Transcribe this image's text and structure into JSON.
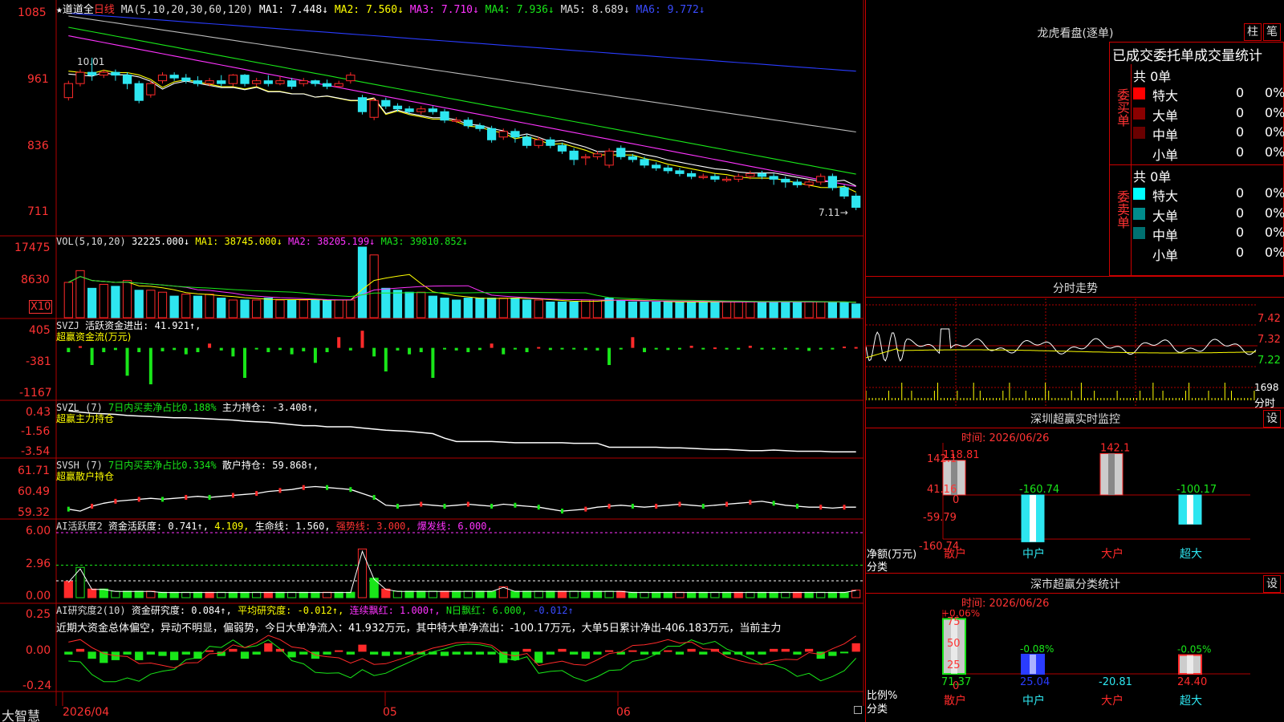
{
  "colors": {
    "up": "#ff2a2a",
    "down": "#2ee6f0",
    "green": "#19e619",
    "yellow": "#ffff00",
    "magenta": "#ff33ff",
    "grid": "#b00000",
    "white": "#ffffff",
    "blue": "#2a3cff"
  },
  "header": {
    "star": "★",
    "name": "道道全",
    "period": "日线",
    "ma_label": "MA(5,10,20,30,60,120)",
    "ma1": "MA1: 7.448↓",
    "ma2": "MA2: 7.560↓",
    "ma3": "MA3: 7.710↓",
    "ma4": "MA4: 7.936↓",
    "ma5": "MA5: 8.689↓",
    "ma6": "MA6: 9.772↓"
  },
  "main_axis": {
    "t1": "1085",
    "t2": "961",
    "t3": "836",
    "t4": "711"
  },
  "main_annot": {
    "high": "10.01",
    "low": "7.11→"
  },
  "vol": {
    "label": "VOL(5,10,20)",
    "v": "32225.000↓",
    "ma1": "MA1: 38745.000↓",
    "ma2": "MA2: 38205.199↓",
    "ma3": "MA3: 39810.852↓",
    "t1": "17475",
    "t2": "8630",
    "unit": "X10"
  },
  "svzj": {
    "label": "SVZJ",
    "val": "活跃资金进出: 41.921↑,",
    "sub": "超赢资金流(万元)",
    "t1": "405",
    "t2": "-381",
    "t3": "-1167"
  },
  "svzl": {
    "label": "SVZL (7)",
    "g": "7日内买卖净占比0.188%",
    "w": "主力持仓: -3.408↑,",
    "sub": "超赢主力持仓",
    "t1": "0.43",
    "t2": "-1.56",
    "t3": "-3.54"
  },
  "svsh": {
    "label": "SVSH (7)",
    "g": "7日内买卖净占比0.334%",
    "w": "散户持仓: 59.868↑,",
    "sub": "超赢散户持仓",
    "t1": "61.71",
    "t2": "60.49",
    "t3": "59.32"
  },
  "ai1": {
    "label": "AI活跃度2",
    "a": "资金活跃度: 0.741↑,",
    "b": "4.109,",
    "c": "生命线: 1.560,",
    "d": "强势线: 3.000,",
    "e": "爆发线: 6.000,",
    "t1": "6.00",
    "t2": "2.96",
    "t3": "0.00"
  },
  "ai2": {
    "label": "AI研究度2(10)",
    "a": "资金研究度: 0.084↑,",
    "b": "平均研究度: -0.012↑,",
    "c": "连续飘红: 1.000↑,",
    "d": "N日飘红: 6.000,",
    "e": "-0.012↑",
    "comment": "近期大资金总体偏空，异动不明显，偏弱势，今日大单净流入：41.932万元，其中特大单净流出：-100.17万元，大单5日累计净出-406.183万元，当前主力",
    "t1": "0.25",
    "t2": "0.00",
    "t3": "-0.24"
  },
  "bottom": {
    "brand": "大智慧",
    "d1": "2026/04",
    "d2": "05",
    "d3": "06"
  },
  "right": {
    "title": "龙虎看盘(逐单)",
    "btn1": "柱",
    "btn2": "笔",
    "sub_title": "已成交委托单成交量统计",
    "buy_side": "委买单",
    "sell_side": "委卖单",
    "buy_total": "共 0单",
    "sell_total": "共 0单",
    "buy_rows": [
      {
        "name": "特大",
        "n": "0",
        "p": "0%",
        "color": "#ff0000"
      },
      {
        "name": "大单",
        "n": "0",
        "p": "0%",
        "color": "#8b0000"
      },
      {
        "name": "中单",
        "n": "0",
        "p": "0%",
        "color": "#6a0000"
      },
      {
        "name": "小单",
        "n": "0",
        "p": "0%",
        "color": ""
      }
    ],
    "sell_rows": [
      {
        "name": "特大",
        "n": "0",
        "p": "0%",
        "color": "#00ffff"
      },
      {
        "name": "大单",
        "n": "0",
        "p": "0%",
        "color": "#008b8b"
      },
      {
        "name": "中单",
        "n": "0",
        "p": "0%",
        "color": "#007070"
      },
      {
        "name": "小单",
        "n": "0",
        "p": "0%",
        "color": ""
      }
    ],
    "intraday_title": "分时走势",
    "intraday_ticks": {
      "p1": "7.42",
      "p2": "7.32",
      "p3": "7.22",
      "v": "1698",
      "unit": "分时"
    },
    "monitor_title": "深圳超赢实时监控",
    "monitor_btn": "设",
    "monitor_time": "时间: 2026/06/26",
    "monitor_axis": {
      "t1": "142.1",
      "t2": "41.16",
      "t3": "0",
      "t4": "-59.79",
      "t5": "-160.74",
      "unit1": "净额(万元)",
      "unit2": "分类"
    },
    "stats_title": "深市超赢分类统计",
    "stats_btn": "设",
    "stats_time": "时间: 2026/06/26",
    "stats_axis": {
      "t1": "75",
      "t2": "50",
      "t3": "25",
      "t4": "0",
      "unit1": "比例%",
      "unit2": "分类"
    }
  },
  "chart_data": [
    {
      "type": "candlestick",
      "title": "道道全 日线",
      "ylim": [
        6.9,
        10.95
      ],
      "ohlc": [
        [
          9.3,
          9.55,
          9.25,
          9.6
        ],
        [
          9.55,
          9.75,
          9.5,
          9.8
        ],
        [
          9.75,
          9.7,
          9.6,
          10.01
        ],
        [
          9.7,
          9.75,
          9.65,
          9.8
        ],
        [
          9.75,
          9.7,
          9.6,
          9.8
        ],
        [
          9.7,
          9.55,
          9.45,
          9.75
        ],
        [
          9.55,
          9.25,
          9.2,
          9.6
        ],
        [
          9.35,
          9.55,
          9.3,
          9.6
        ],
        [
          9.6,
          9.7,
          9.55,
          9.75
        ],
        [
          9.7,
          9.65,
          9.6,
          9.75
        ],
        [
          9.65,
          9.6,
          9.55,
          9.72
        ],
        [
          9.6,
          9.55,
          9.5,
          9.68
        ],
        [
          9.55,
          9.6,
          9.5,
          9.65
        ],
        [
          9.6,
          9.55,
          9.5,
          9.7
        ],
        [
          9.55,
          9.7,
          9.5,
          9.72
        ],
        [
          9.7,
          9.55,
          9.5,
          9.72
        ],
        [
          9.55,
          9.6,
          9.5,
          9.65
        ],
        [
          9.6,
          9.55,
          9.5,
          9.7
        ],
        [
          9.55,
          9.6,
          9.52,
          9.68
        ],
        [
          9.6,
          9.5,
          9.45,
          9.65
        ],
        [
          9.55,
          9.6,
          9.5,
          9.65
        ],
        [
          9.6,
          9.55,
          9.5,
          9.62
        ],
        [
          9.55,
          9.5,
          9.45,
          9.62
        ],
        [
          9.5,
          9.55,
          9.48,
          9.6
        ],
        [
          9.6,
          9.7,
          9.55,
          9.75
        ],
        [
          9.3,
          9.05,
          9.0,
          9.35
        ],
        [
          8.95,
          9.25,
          8.9,
          9.3
        ],
        [
          9.25,
          9.15,
          9.1,
          9.3
        ],
        [
          9.15,
          9.1,
          9.05,
          9.2
        ],
        [
          9.1,
          9.05,
          9.0,
          9.15
        ],
        [
          9.05,
          9.1,
          9.0,
          9.15
        ],
        [
          9.1,
          9.05,
          9.0,
          9.15
        ],
        [
          9.05,
          8.9,
          8.85,
          9.1
        ],
        [
          8.9,
          8.9,
          8.85,
          8.95
        ],
        [
          8.9,
          8.8,
          8.75,
          8.95
        ],
        [
          8.8,
          8.75,
          8.7,
          8.85
        ],
        [
          8.75,
          8.55,
          8.5,
          8.8
        ],
        [
          8.6,
          8.7,
          8.55,
          8.75
        ],
        [
          8.7,
          8.6,
          8.5,
          8.75
        ],
        [
          8.6,
          8.45,
          8.4,
          8.65
        ],
        [
          8.45,
          8.55,
          8.4,
          8.6
        ],
        [
          8.55,
          8.45,
          8.4,
          8.6
        ],
        [
          8.45,
          8.35,
          8.3,
          8.5
        ],
        [
          8.35,
          8.2,
          8.1,
          8.4
        ],
        [
          8.25,
          8.25,
          8.1,
          8.3
        ],
        [
          8.25,
          8.3,
          8.2,
          8.35
        ],
        [
          8.1,
          8.35,
          8.05,
          8.4
        ],
        [
          8.4,
          8.25,
          8.2,
          8.45
        ],
        [
          8.25,
          8.2,
          8.15,
          8.3
        ],
        [
          8.2,
          8.1,
          8.05,
          8.25
        ],
        [
          8.1,
          8.05,
          8.0,
          8.15
        ],
        [
          8.05,
          8.0,
          7.95,
          8.1
        ],
        [
          8.0,
          7.95,
          7.9,
          8.05
        ],
        [
          7.95,
          7.9,
          7.85,
          8.0
        ],
        [
          7.9,
          7.9,
          7.85,
          7.95
        ],
        [
          7.9,
          7.85,
          7.8,
          7.95
        ],
        [
          7.85,
          7.85,
          7.8,
          7.9
        ],
        [
          7.85,
          7.9,
          7.8,
          7.95
        ],
        [
          7.9,
          7.95,
          7.85,
          8.0
        ],
        [
          7.95,
          7.9,
          7.85,
          8.0
        ],
        [
          7.9,
          7.85,
          7.75,
          7.95
        ],
        [
          7.85,
          7.8,
          7.7,
          7.9
        ],
        [
          7.8,
          7.75,
          7.7,
          7.85
        ],
        [
          7.75,
          7.8,
          7.7,
          7.85
        ],
        [
          7.8,
          7.9,
          7.75,
          7.95
        ],
        [
          7.9,
          7.7,
          7.65,
          7.95
        ],
        [
          7.7,
          7.55,
          7.5,
          7.75
        ],
        [
          7.55,
          7.35,
          7.3,
          7.6
        ]
      ],
      "ma_series": [
        {
          "name": "MA1",
          "color": "#ffff00",
          "start": 9.85,
          "end": 7.5
        },
        {
          "name": "MA2",
          "color": "#ffffff",
          "start": 9.7,
          "end": 7.62
        },
        {
          "name": "MA3",
          "color": "#ff33ff",
          "start": 10.4,
          "end": 7.72
        },
        {
          "name": "MA4",
          "color": "#19e619",
          "start": 10.55,
          "end": 7.94
        },
        {
          "name": "MA5",
          "color": "#bbbbbb",
          "start": 10.75,
          "end": 8.69
        },
        {
          "name": "MA6",
          "color": "#2a3cff",
          "start": 10.8,
          "end": 9.77
        }
      ]
    },
    {
      "type": "bar",
      "title": "VOL(5,10,20)",
      "ylim": [
        0,
        18000
      ],
      "values": [
        9000,
        12000,
        7500,
        8500,
        8000,
        9500,
        7000,
        7000,
        6500,
        5500,
        6000,
        5500,
        6000,
        5000,
        4500,
        4500,
        4500,
        5000,
        4500,
        4500,
        4500,
        4500,
        4500,
        4500,
        4500,
        18000,
        16000,
        7500,
        7000,
        6500,
        6500,
        5500,
        5000,
        4500,
        5000,
        5000,
        5000,
        5000,
        5000,
        4500,
        4500,
        4000,
        4000,
        4000,
        4500,
        4500,
        5000,
        4500,
        4000,
        4000,
        4000,
        4000,
        4000,
        4000,
        4000,
        4000,
        4000,
        4000,
        4000,
        4000,
        4000,
        4000,
        4000,
        4000,
        4000,
        4000,
        4000,
        3500
      ],
      "ups": [
        1,
        1,
        0,
        1,
        0,
        1,
        0,
        1,
        1,
        0,
        1,
        0,
        1,
        0,
        1,
        0,
        1,
        0,
        1,
        0,
        1,
        0,
        0,
        1,
        1,
        0,
        1,
        0,
        0,
        0,
        1,
        0,
        0,
        0,
        0,
        0,
        0,
        1,
        0,
        0,
        1,
        0,
        0,
        0,
        1,
        1,
        0,
        0,
        0,
        0,
        0,
        0,
        0,
        0,
        0,
        0,
        1,
        1,
        1,
        0,
        0,
        0,
        0,
        1,
        1,
        0,
        0,
        0
      ]
    },
    {
      "type": "bar",
      "title": "SVZJ",
      "ylim": [
        -1167,
        405
      ],
      "values": [
        -100,
        40,
        -400,
        -100,
        -50,
        -650,
        -100,
        -850,
        -80,
        -50,
        -150,
        -100,
        100,
        -60,
        -200,
        -700,
        -20,
        -100,
        -50,
        -150,
        -80,
        -350,
        -100,
        250,
        -60,
        400,
        -200,
        -550,
        -60,
        -150,
        -100,
        -700,
        -20,
        -60,
        -100,
        -50,
        100,
        -150,
        -20,
        -100,
        20,
        -50,
        -20,
        -10,
        -50,
        -60,
        -400,
        -20,
        250,
        -100,
        -30,
        -50,
        -20,
        50,
        -20,
        10,
        -20,
        -30,
        50,
        -20,
        -10,
        -30,
        -10,
        -70,
        -30,
        -20,
        30,
        20
      ],
      "ups": [
        0,
        1,
        0,
        0,
        0,
        0,
        0,
        0,
        0,
        0,
        0,
        0,
        1,
        0,
        0,
        0,
        0,
        0,
        0,
        0,
        0,
        0,
        0,
        1,
        0,
        1,
        0,
        0,
        0,
        0,
        0,
        0,
        0,
        0,
        0,
        0,
        1,
        0,
        0,
        0,
        1,
        0,
        0,
        0,
        0,
        0,
        0,
        0,
        1,
        0,
        0,
        0,
        0,
        1,
        0,
        1,
        0,
        0,
        1,
        0,
        0,
        0,
        0,
        0,
        0,
        0,
        1,
        1
      ]
    },
    {
      "type": "line",
      "title": "SVZL (7)",
      "ylim": [
        -3.6,
        0.5
      ],
      "values": [
        0.2,
        0.1,
        0.0,
        -0.05,
        -0.1,
        -0.2,
        -0.25,
        -0.3,
        -0.35,
        -0.4,
        -0.4,
        -0.45,
        -0.5,
        -0.55,
        -0.6,
        -0.7,
        -0.75,
        -0.8,
        -0.9,
        -1.0,
        -1.1,
        -1.1,
        -1.2,
        -1.2,
        -1.2,
        -1.3,
        -1.4,
        -1.5,
        -1.55,
        -1.6,
        -1.7,
        -1.8,
        -2.2,
        -2.5,
        -2.5,
        -2.5,
        -2.5,
        -2.55,
        -2.6,
        -2.6,
        -2.6,
        -2.6,
        -2.6,
        -2.65,
        -2.65,
        -2.65,
        -3.0,
        -3.0,
        -3.0,
        -3.0,
        -3.0,
        -3.05,
        -3.05,
        -3.1,
        -3.15,
        -3.2,
        -3.2,
        -3.25,
        -3.3,
        -3.3,
        -3.25,
        -3.3,
        -3.35,
        -3.35,
        -3.35,
        -3.4,
        -3.4,
        -3.4
      ]
    },
    {
      "type": "line",
      "title": "SVSH (7)",
      "ylim": [
        59.3,
        61.75
      ],
      "values": [
        59.6,
        59.5,
        59.75,
        59.9,
        60.0,
        60.05,
        60.1,
        60.15,
        60.1,
        60.15,
        60.2,
        60.25,
        60.2,
        60.25,
        60.3,
        60.35,
        60.4,
        60.5,
        60.55,
        60.6,
        60.7,
        60.75,
        60.7,
        60.65,
        60.6,
        60.4,
        60.2,
        59.8,
        59.75,
        59.8,
        59.85,
        59.8,
        59.75,
        59.8,
        59.85,
        59.8,
        59.75,
        59.85,
        59.8,
        59.75,
        59.7,
        59.6,
        59.5,
        59.55,
        59.6,
        59.7,
        59.75,
        59.8,
        59.75,
        59.7,
        59.75,
        59.8,
        59.85,
        59.8,
        59.75,
        59.8,
        59.85,
        59.9,
        59.95,
        60.0,
        59.9,
        59.8,
        59.75,
        59.7,
        59.7,
        59.65,
        59.7,
        59.7
      ]
    },
    {
      "type": "bar",
      "title": "AI活跃度2",
      "ylim": [
        0,
        6.3
      ],
      "values": [
        1.5,
        2.8,
        0.8,
        0.8,
        0.6,
        0.6,
        0.6,
        0.6,
        0.5,
        0.5,
        0.5,
        0.5,
        0.5,
        0.5,
        0.5,
        0.5,
        0.5,
        0.5,
        0.5,
        0.5,
        0.5,
        0.5,
        0.5,
        0.5,
        0.5,
        4.5,
        1.8,
        0.8,
        0.6,
        0.6,
        0.6,
        0.6,
        0.6,
        0.6,
        0.6,
        0.6,
        0.6,
        1.0,
        0.6,
        0.6,
        0.6,
        0.6,
        0.6,
        0.6,
        0.6,
        0.6,
        0.6,
        0.6,
        0.5,
        0.5,
        0.5,
        0.5,
        0.5,
        0.5,
        0.5,
        0.5,
        0.5,
        0.5,
        0.5,
        0.5,
        0.5,
        0.5,
        0.5,
        0.5,
        0.5,
        0.5,
        0.5,
        0.7
      ],
      "lines": {
        "life": 1.56,
        "strong": 3.0,
        "burst": 6.0
      }
    },
    {
      "type": "bar",
      "title": "AI研究度2(10)",
      "ylim": [
        -0.26,
        0.27
      ],
      "values": [
        -0.02,
        0.02,
        -0.05,
        -0.08,
        -0.06,
        -0.02,
        -0.06,
        -0.02,
        -0.03,
        -0.06,
        -0.02,
        -0.05,
        0.01,
        -0.03,
        0.02,
        -0.05,
        -0.02,
        0.06,
        0.02,
        -0.04,
        -0.02,
        -0.05,
        -0.02,
        0.01,
        -0.02,
        0.05,
        -0.02,
        -0.03,
        -0.02,
        -0.02,
        -0.02,
        -0.02,
        -0.03,
        -0.02,
        -0.02,
        -0.02,
        -0.02,
        -0.08,
        -0.06,
        0.02,
        -0.08,
        -0.02,
        0.02,
        -0.02,
        -0.05,
        -0.02,
        0.01,
        -0.02,
        0.01,
        -0.02,
        -0.02,
        0.01,
        -0.02,
        0.02,
        -0.02,
        0.02,
        -0.02,
        -0.02,
        -0.02,
        -0.02,
        0.02,
        0.02,
        -0.02,
        0.02,
        -0.05,
        -0.03,
        -0.01,
        0.06
      ]
    },
    {
      "type": "bar",
      "title": "深圳超赢实时监控",
      "categories": [
        "散户",
        "中户",
        "大户",
        "超大"
      ],
      "values": [
        118.81,
        -160.74,
        142.1,
        -100.17
      ],
      "ylim": [
        -160.74,
        142.1
      ]
    },
    {
      "type": "bar",
      "title": "深市超赢分类统计",
      "categories": [
        "散户",
        "中户",
        "大户",
        "超大"
      ],
      "values": [
        71.37,
        25.04,
        -20.81,
        24.4
      ],
      "changes": [
        "+0.06%",
        "-0.08%",
        "",
        "-0.05%"
      ],
      "bottom_labels": [
        "71.37",
        "25.04",
        "-20.81",
        "24.40"
      ],
      "ylim": [
        0,
        75
      ]
    }
  ]
}
